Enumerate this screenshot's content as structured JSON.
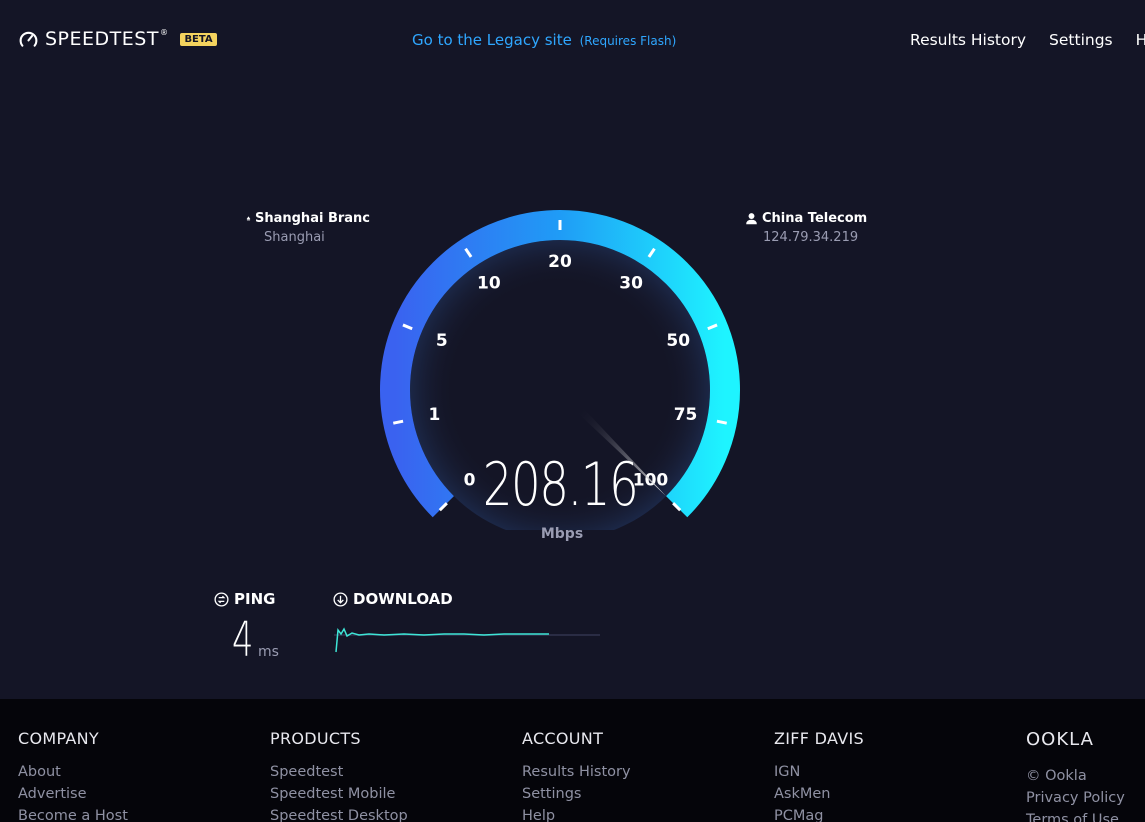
{
  "header": {
    "brand": "SPEEDTEST",
    "brand_mark": "®",
    "badge": "BETA",
    "legacy_link": "Go to the Legacy site",
    "legacy_note": "(Requires Flash)",
    "nav": [
      "Results History",
      "Settings",
      "H"
    ]
  },
  "server": {
    "name": "Shanghai Branc",
    "location": "Shanghai",
    "icon": "server-icon"
  },
  "isp": {
    "name": "China Telecom",
    "ip": "124.79.34.219",
    "icon": "user-icon"
  },
  "gauge": {
    "labels": [
      "0",
      "1",
      "5",
      "10",
      "20",
      "30",
      "50",
      "75",
      "100"
    ],
    "value": "208.16",
    "unit": "Mbps",
    "colors": {
      "start": "#3a64f2",
      "end": "#1ef2ff"
    }
  },
  "results": {
    "ping_label": "PING",
    "ping_value": "4",
    "ping_unit": "ms",
    "download_label": "DOWNLOAD",
    "graph_color": "#3ee5d6"
  },
  "footer": {
    "columns": [
      {
        "title": "COMPANY",
        "links": [
          "About",
          "Advertise",
          "Become a Host"
        ]
      },
      {
        "title": "PRODUCTS",
        "links": [
          "Speedtest",
          "Speedtest Mobile",
          "Speedtest Desktop"
        ]
      },
      {
        "title": "ACCOUNT",
        "links": [
          "Results History",
          "Settings",
          "Help"
        ]
      },
      {
        "title": "ZIFF DAVIS",
        "links": [
          "IGN",
          "AskMen",
          "PCMag"
        ]
      },
      {
        "title": "OOKLA",
        "links": [
          "© Ookla",
          "Privacy Policy",
          "Terms of Use"
        ]
      }
    ]
  }
}
